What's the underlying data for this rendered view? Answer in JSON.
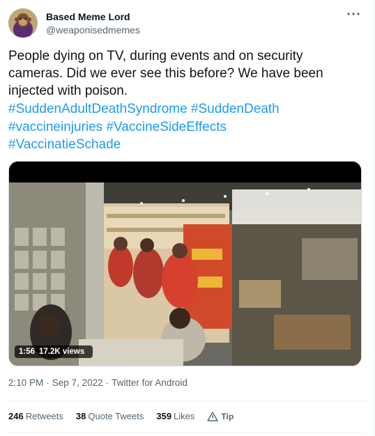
{
  "author": {
    "display_name": "Based Meme Lord",
    "handle": "@weaponisedmemes",
    "avatar_icon": "avatar-monkey-portrait"
  },
  "tweet": {
    "text": "People dying on TV, during events and on security cameras. Did we ever see this before? We have been injected with poison.",
    "hashtags": [
      "#SuddenAdultDeathSyndrome",
      "#SuddenDeath",
      "#vaccineinjuries",
      "#VaccineSideEffects",
      "#VaccinatieSchade"
    ]
  },
  "video": {
    "duration": "1:56",
    "views": "17.2K views"
  },
  "meta": {
    "time": "2:10 PM",
    "date": "Sep 7, 2022",
    "source": "Twitter for Android",
    "separator": "·"
  },
  "stats": {
    "retweets_count": "246",
    "retweets_label": "Retweets",
    "quotes_count": "38",
    "quotes_label": "Quote Tweets",
    "likes_count": "359",
    "likes_label": "Likes",
    "tip_label": "Tip"
  },
  "colors": {
    "link": "#1d9bf0",
    "secondary_text": "#536471",
    "primary_text": "#0f1419"
  }
}
